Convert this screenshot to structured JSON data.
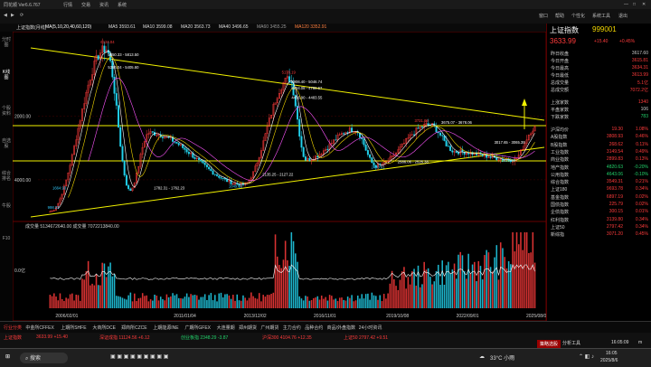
{
  "window": {
    "title": "同花顺 Ver6.6.767",
    "menu": [
      "行情",
      "交易",
      "资讯",
      "系统"
    ]
  },
  "topbar": {
    "right_items": [
      "窗口",
      "帮助",
      "个性化",
      "系统工具",
      "退出"
    ]
  },
  "left_tabs": [
    "分时图",
    "K线图",
    "个股资料",
    "自选股",
    "综合排名",
    "牛股",
    "F10"
  ],
  "legend": {
    "title": "上证指数(月线)",
    "ma_params": "MA(5,10,20,40,60,120)",
    "ma_items": [
      {
        "label": "MA5 3593.61",
        "color": "#ffffff"
      },
      {
        "label": "MA10 3599.08",
        "color": "#f2d600"
      },
      {
        "label": "MA20 3563.73",
        "color": "#ff55ff"
      },
      {
        "label": "MA40 3496.65",
        "color": "#22d36b"
      },
      {
        "label": "MA60 3455.25",
        "color": "#999999"
      },
      {
        "label": "MA120 3352.91",
        "color": "#ff8040"
      }
    ],
    "volume": "成交量 5134672640.00  成交量 7072213840.00"
  },
  "annotations": [
    "6124.04",
    "5850.33 - 5813.50",
    "5386.04 - 5405.60",
    "5178.19",
    "4906.40 - 5046.74",
    "4794.08 - 4780.67",
    "4456.90 - 4483.55",
    "3731.69",
    "3675.07 - 3678.06",
    "1782.31 - 1762.23",
    "1849.65",
    "2135.25 - 2127.22",
    "2440.91",
    "2586.06 - 2526.38",
    "2635.09",
    "1664.93",
    "998.23",
    "3017.65 - 3065.39"
  ],
  "price_axis": [
    "4000.00",
    "2000.00"
  ],
  "vol_axis": [
    "0.0亿"
  ],
  "date_axis": [
    "2006/02/01",
    "2011/01/04",
    "2013/12/02",
    "2016/11/01",
    "2019/10/08",
    "2022/09/01",
    "2025/08/06"
  ],
  "right_panel": {
    "title": "上证指数",
    "code": "999001",
    "price": "3633.99",
    "change": "+15.40",
    "pct": "+0.45%",
    "stats": [
      {
        "k": "昨日收盘",
        "v": "3617.60"
      },
      {
        "k": "今日开盘",
        "v": "3615.81"
      },
      {
        "k": "今日最高",
        "v": "3634.31"
      },
      {
        "k": "今日最低",
        "v": "3613.99"
      },
      {
        "k": "总成交量",
        "v": "5.1亿"
      },
      {
        "k": "总成交额",
        "v": "7072.2亿"
      },
      {
        "k": "上涨家数",
        "v": "1340"
      },
      {
        "k": "平盘家数",
        "v": "106"
      },
      {
        "k": "下跌家数",
        "v": "783"
      }
    ],
    "indices": [
      {
        "k": "沪深均价",
        "v": "19.30",
        "p": "1.08%"
      },
      {
        "k": "A股指数",
        "v": "3808.93",
        "p": "0.46%"
      },
      {
        "k": "B股指数",
        "v": "268.62",
        "p": "0.11%"
      },
      {
        "k": "工业指数",
        "v": "3149.54",
        "p": "0.49%"
      },
      {
        "k": "商业指数",
        "v": "2899.83",
        "p": "0.13%"
      },
      {
        "k": "地产指数",
        "v": "4820.63",
        "p": "-0.20%"
      },
      {
        "k": "公用指数",
        "v": "4643.06",
        "p": "-0.10%"
      },
      {
        "k": "综合指数",
        "v": "3549.31",
        "p": "0.21%"
      },
      {
        "k": "上证180",
        "v": "9693.78",
        "p": "0.34%"
      },
      {
        "k": "基金指数",
        "v": "6897.19",
        "p": "0.02%"
      },
      {
        "k": "国债指数",
        "v": "225.79",
        "p": "0.02%"
      },
      {
        "k": "企债指数",
        "v": "300.15",
        "p": "0.01%"
      },
      {
        "k": "红利指数",
        "v": "3139.80",
        "p": "0.34%"
      },
      {
        "k": "上证50",
        "v": "2797.42",
        "p": "0.34%"
      },
      {
        "k": "新综指",
        "v": "3071.20",
        "p": "0.45%"
      }
    ]
  },
  "bottom_tabs": [
    "行业分类",
    "中金所CFFEX",
    "上期所SHFE",
    "大商所DCE",
    "郑商所CZCE",
    "上期能源INE",
    "广期所GFEX",
    "大连量期",
    "郑州期货",
    "广州期货",
    "主力合约",
    "品种合约",
    "商品/外盘指数",
    "24小时资讯"
  ],
  "index_strip": [
    {
      "text": "上证指数",
      "color": "#ff3b3b"
    },
    {
      "text": "3633.99 +15.40",
      "color": "#ff3b3b"
    },
    {
      "text": "深证成指 11124.56 +6.12",
      "color": "#ff3b3b"
    },
    {
      "text": "创业板指 2348.29 -3.87",
      "color": "#22d36b"
    },
    {
      "text": "沪深300 4104.76 +12.35",
      "color": "#ff3b3b"
    },
    {
      "text": "上证50 2797.42 +9.51",
      "color": "#ff3b3b"
    }
  ],
  "status_right": [
    "策略选股",
    "分析工具",
    "16:05:09",
    "m"
  ],
  "taskbar": {
    "search": "搜索",
    "weather": "33°C 小雨",
    "time": "16:05",
    "date": "2025/8/6"
  },
  "chart_data": {
    "type": "candlestick",
    "title": "上证指数(月线)",
    "x_axis_labels": [
      "2006/02/01",
      "2011/01/04",
      "2013/12/02",
      "2016/11/01",
      "2019/10/08",
      "2022/09/01",
      "2025/08/06"
    ],
    "ylim": [
      800,
      6500
    ],
    "y_ticks": [
      2000,
      4000
    ],
    "grid": true,
    "key_points": [
      {
        "x": 2005.5,
        "y": 998
      },
      {
        "x": 2007.8,
        "y": 6124
      },
      {
        "x": 2008.8,
        "y": 1664
      },
      {
        "x": 2009.6,
        "y": 3478
      },
      {
        "x": 2013.5,
        "y": 1849
      },
      {
        "x": 2015.4,
        "y": 5178
      },
      {
        "x": 2016.1,
        "y": 2638
      },
      {
        "x": 2018.1,
        "y": 3587
      },
      {
        "x": 2019.0,
        "y": 2440
      },
      {
        "x": 2021.2,
        "y": 3731
      },
      {
        "x": 2022.3,
        "y": 2886
      },
      {
        "x": 2024.7,
        "y": 2635
      },
      {
        "x": 2025.6,
        "y": 3634
      }
    ]
  }
}
